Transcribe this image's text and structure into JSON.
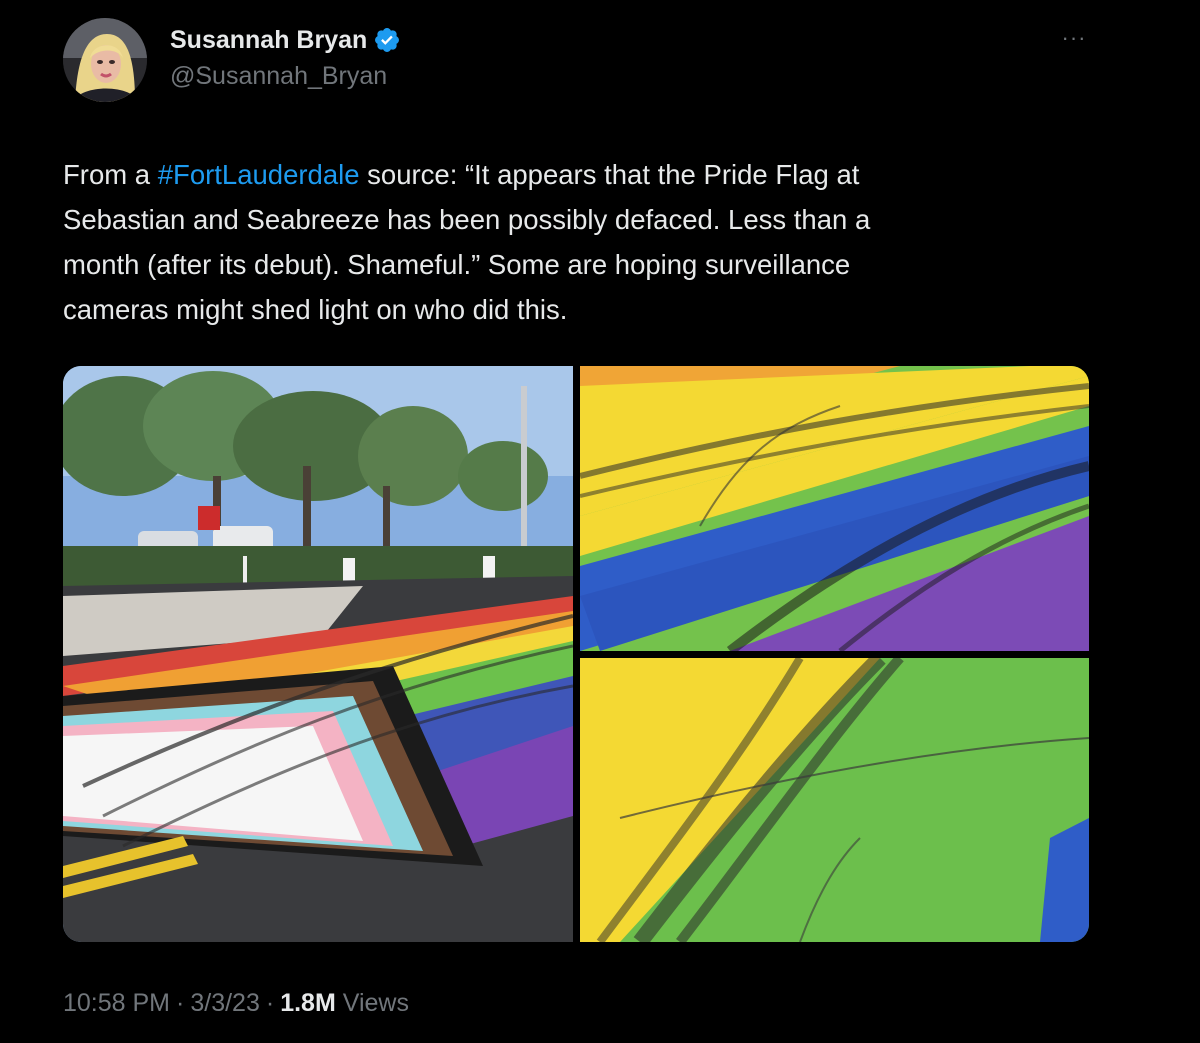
{
  "author": {
    "display_name": "Susannah Bryan",
    "handle": "@Susannah_Bryan",
    "verified_icon": "verified-badge-icon",
    "avatar_icon": "profile-photo"
  },
  "menu": {
    "more_label": "···",
    "icon": "more-horizontal-icon"
  },
  "tweet": {
    "text_before": "From a ",
    "hashtag": "#FortLauderdale",
    "text_after": " source: “It appears that the Pride Flag at\nSebastian and Seabreeze has been possibly defaced.  Less than a\nmonth (after its debut). Shameful.” Some are hoping surveillance\ncameras might shed light on who did this."
  },
  "media": {
    "images": [
      {
        "name": "street-crosswalk-photo"
      },
      {
        "name": "tire-marks-closeup-photo-1"
      },
      {
        "name": "tire-marks-closeup-photo-2"
      }
    ]
  },
  "meta": {
    "time": "10:58 PM",
    "separator": "·",
    "date": "3/3/23",
    "views_count": "1.8M",
    "views_label": "Views"
  },
  "colors": {
    "background": "#000000",
    "text": "#e7e9ea",
    "secondary": "#71767b",
    "accent": "#1d9bf0"
  }
}
